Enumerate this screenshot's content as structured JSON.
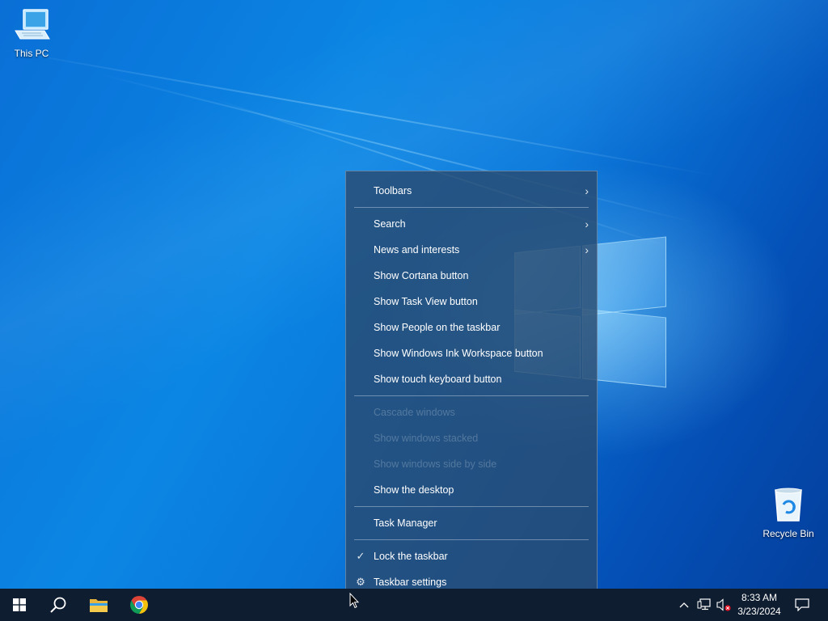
{
  "desktop": {
    "icons": [
      {
        "label": "This PC",
        "icon": "this-pc-icon"
      },
      {
        "label": "Recycle Bin",
        "icon": "recycle-bin-icon"
      }
    ]
  },
  "context_menu": {
    "items": [
      {
        "label": "Toolbars",
        "has_submenu": true
      },
      {
        "label": "Search",
        "has_submenu": true
      },
      {
        "label": "News and interests",
        "has_submenu": true
      },
      {
        "label": "Show Cortana button"
      },
      {
        "label": "Show Task View button"
      },
      {
        "label": "Show People on the taskbar"
      },
      {
        "label": "Show Windows Ink Workspace button"
      },
      {
        "label": "Show touch keyboard button"
      },
      {
        "label": "Cascade windows",
        "disabled": true
      },
      {
        "label": "Show windows stacked",
        "disabled": true
      },
      {
        "label": "Show windows side by side",
        "disabled": true
      },
      {
        "label": "Show the desktop"
      },
      {
        "label": "Task Manager"
      },
      {
        "label": "Lock the taskbar",
        "checked": true
      },
      {
        "label": "Taskbar settings",
        "icon": "gear-icon"
      }
    ]
  },
  "taskbar": {
    "apps": [
      "start-button",
      "search-button",
      "file-explorer",
      "chrome"
    ],
    "tray": {
      "time": "8:33 AM",
      "date": "3/23/2024"
    }
  },
  "colors": {
    "menu_bg": "#284a70",
    "taskbar_bg": "#0f1d30",
    "accent": "#0a78db"
  }
}
